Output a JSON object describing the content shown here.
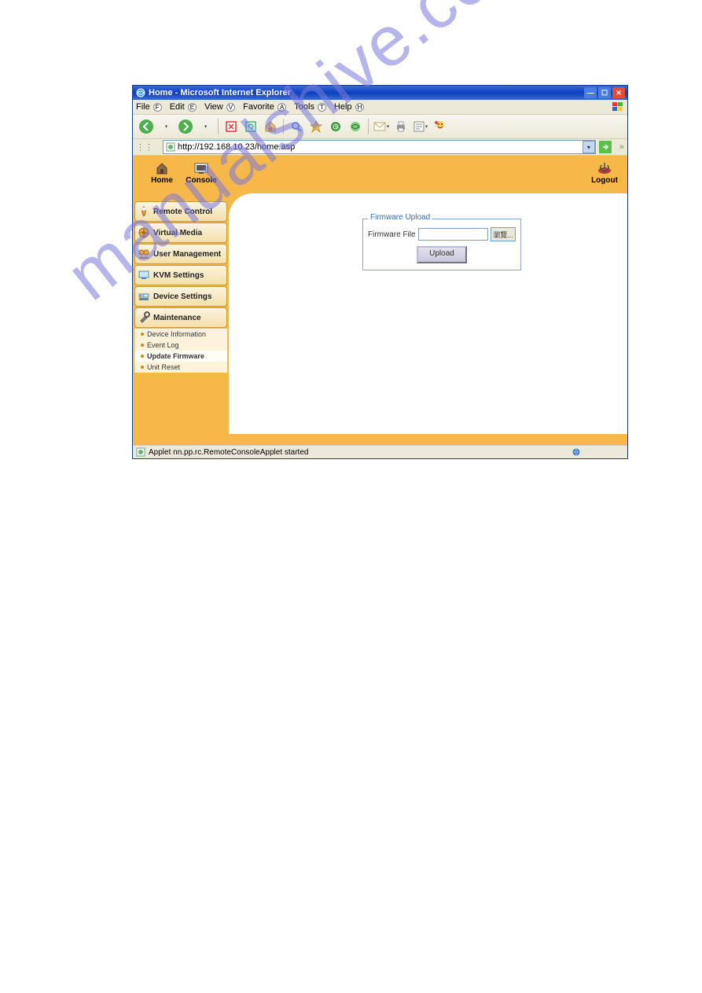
{
  "window": {
    "title": "Home - Microsoft Internet Explorer"
  },
  "menubar": {
    "items": [
      {
        "label": "File",
        "hotkey": "F"
      },
      {
        "label": "Edit",
        "hotkey": "E"
      },
      {
        "label": "View",
        "hotkey": "V"
      },
      {
        "label": "Favorite",
        "hotkey": "A"
      },
      {
        "label": "Tools",
        "hotkey": "T"
      },
      {
        "label": "Help",
        "hotkey": "H"
      }
    ]
  },
  "addressbar": {
    "url": "http://192.168.10.23/home.asp"
  },
  "topbar": {
    "home": "Home",
    "console": "Console",
    "logout": "Logout"
  },
  "sidebar": {
    "groups": [
      {
        "label": "Remote Control"
      },
      {
        "label": "Virtual Media"
      },
      {
        "label": "User Management"
      },
      {
        "label": "KVM Settings"
      },
      {
        "label": "Device Settings"
      },
      {
        "label": "Maintenance"
      }
    ],
    "sub_items": [
      {
        "label": "Device Information",
        "active": false
      },
      {
        "label": "Event Log",
        "active": false
      },
      {
        "label": "Update Firmware",
        "active": true
      },
      {
        "label": "Unit Reset",
        "active": false
      }
    ]
  },
  "firmware": {
    "legend": "Firmware Upload",
    "file_label": "Firmware File",
    "browse_label": "瀏覽...",
    "upload_label": "Upload"
  },
  "statusbar": {
    "text": "Applet nn.pp.rc.RemoteConsoleApplet started"
  },
  "watermark": "manualshive.com"
}
